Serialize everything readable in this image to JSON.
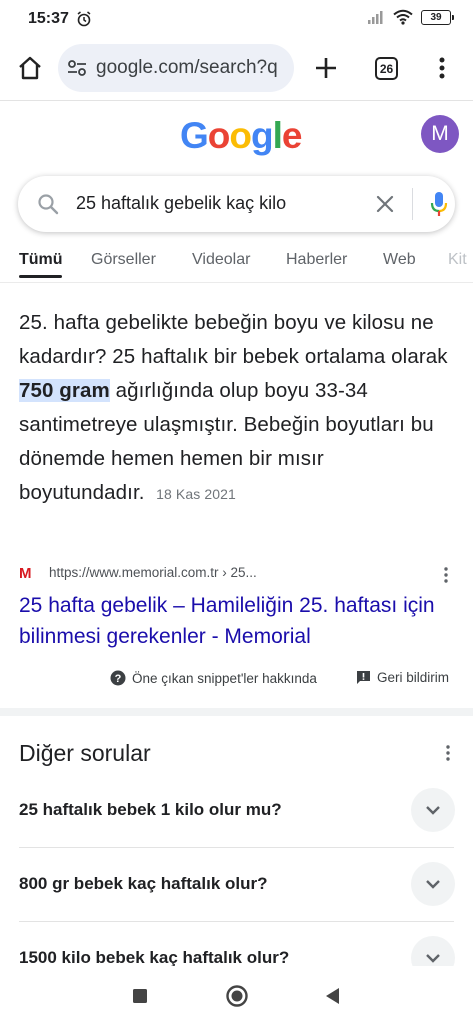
{
  "status": {
    "time": "15:37",
    "battery": "39"
  },
  "browser": {
    "url": "google.com/search?q",
    "tab_count": "26"
  },
  "google": {
    "logo": [
      "G",
      "o",
      "o",
      "g",
      "l",
      "e"
    ],
    "logo_colors": [
      "#4285F4",
      "#EA4335",
      "#FBBC05",
      "#4285F4",
      "#34A853",
      "#EA4335"
    ],
    "avatar_letter": "M",
    "avatar_color": "#7e57c2"
  },
  "search": {
    "query": "25 haftalık gebelik kaç kilo"
  },
  "tabs": [
    "Tümü",
    "Görseller",
    "Videolar",
    "Haberler",
    "Web",
    "Kit"
  ],
  "snippet": {
    "text_before": "25. hafta gebelikte bebeğin boyu ve kilosu ne kadardır? 25 haftalık bir bebek ortalama olarak ",
    "highlight": "750 gram",
    "text_after": " ağırlığında olup boyu 33-34 santimetreye ulaşmıştır. Bebeğin boyutları bu dönemde hemen hemen bir mısır boyutundadır.",
    "date": "18 Kas 2021"
  },
  "result": {
    "favicon": "M",
    "cite": "https://www.memorial.com.tr › 25...",
    "title": "25 hafta gebelik – Hamileliğin 25. haftası için bilinmesi gerekenler - Memorial"
  },
  "featured": {
    "about": "Öne çıkan snippet'ler hakkında",
    "feedback": "Geri bildirim"
  },
  "paa": {
    "title": "Diğer sorular",
    "questions": [
      "25 haftalık bebek 1 kilo olur mu?",
      "800 gr bebek kaç haftalık olur?",
      "1500 kilo bebek kaç haftalık olur?"
    ]
  }
}
